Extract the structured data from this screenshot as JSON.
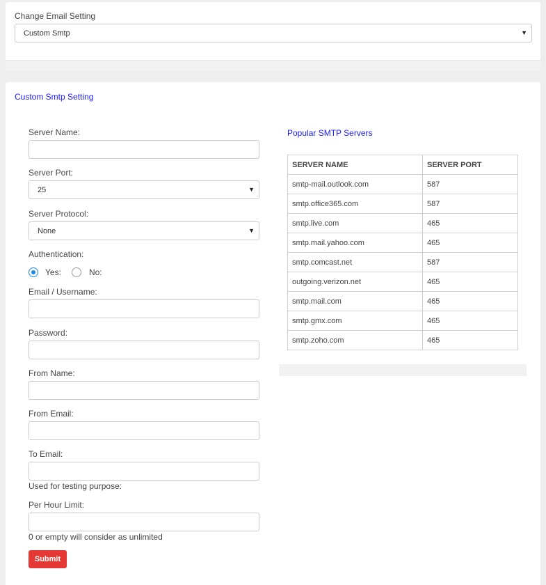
{
  "email_setting": {
    "label": "Change Email Setting",
    "selected": "Custom Smtp"
  },
  "smtp_section": {
    "title": "Custom Smtp Setting",
    "server_name_label": "Server Name:",
    "server_port_label": "Server Port:",
    "server_port_value": "25",
    "server_protocol_label": "Server Protocol:",
    "server_protocol_value": "None",
    "authentication_label": "Authentication:",
    "auth_yes_label": "Yes:",
    "auth_no_label": "No:",
    "auth_selected": "Yes",
    "email_label": "Email / Username:",
    "password_label": "Password:",
    "from_name_label": "From Name:",
    "from_email_label": "From Email:",
    "to_email_label": "To Email:",
    "to_email_help": "Used for testing purpose:",
    "per_hour_label": "Per Hour Limit:",
    "per_hour_help": "0 or empty will consider as unlimited",
    "submit_label": "Submit"
  },
  "popular": {
    "title": "Popular SMTP Servers",
    "headers": [
      "SERVER NAME",
      "SERVER PORT"
    ],
    "rows": [
      [
        "smtp-mail.outlook.com",
        "587"
      ],
      [
        "smtp.office365.com",
        "587"
      ],
      [
        "smtp.live.com",
        "465"
      ],
      [
        "smtp.mail.yahoo.com",
        "465"
      ],
      [
        "smtp.comcast.net",
        "587"
      ],
      [
        "outgoing.verizon.net",
        "465"
      ],
      [
        "smtp.mail.com",
        "465"
      ],
      [
        "smtp.gmx.com",
        "465"
      ],
      [
        "smtp.zoho.com",
        "465"
      ]
    ]
  },
  "colors": {
    "section_title": "#1a1aff",
    "submit": "#e53935",
    "radio_checked": "#1e88e5"
  }
}
